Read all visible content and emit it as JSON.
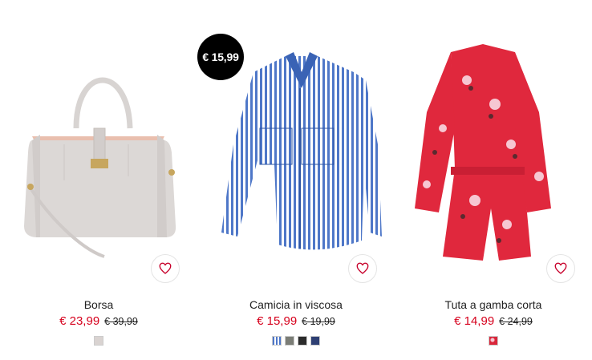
{
  "products": [
    {
      "name": "Borsa",
      "sale_price": "€ 23,99",
      "old_price": "€ 39,99",
      "swatches": [
        "#d9d3d1"
      ]
    },
    {
      "name": "Camicia in viscosa",
      "badge": "€ 15,99",
      "sale_price": "€ 15,99",
      "old_price": "€ 19,99",
      "swatches": [
        "#8fa7d6",
        "#7b7d76",
        "#2b2b2b",
        "#2e3f73"
      ]
    },
    {
      "name": "Tuta a gamba corta",
      "sale_price": "€ 14,99",
      "old_price": "€ 24,99",
      "swatches": [
        "#d9263a"
      ]
    }
  ],
  "colors": {
    "sale": "#d6001c",
    "badge_bg": "#000000",
    "heart": "#c7002b"
  },
  "icons": {
    "favorite": "heart-outline-icon"
  }
}
